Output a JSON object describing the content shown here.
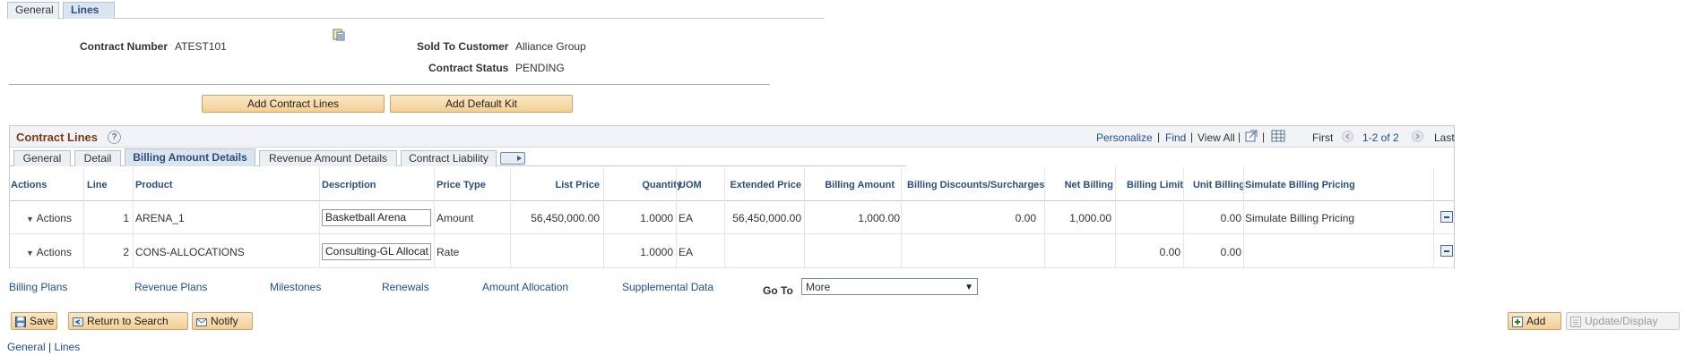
{
  "top_tabs": [
    "General",
    "Lines"
  ],
  "header": {
    "contract_number_label": "Contract Number",
    "contract_number": "ATEST101",
    "sold_to_label": "Sold To Customer",
    "sold_to": "Alliance Group",
    "status_label": "Contract Status",
    "status": "PENDING"
  },
  "buttons": {
    "add_contract_lines": "Add Contract Lines",
    "add_default_kit": "Add Default Kit"
  },
  "grid": {
    "title": "Contract Lines",
    "personalize": "Personalize",
    "find": "Find",
    "view_all": "View All",
    "first": "First",
    "range": "1-2 of 2",
    "last": "Last",
    "tabs": [
      "General",
      "Detail",
      "Billing Amount Details",
      "Revenue Amount Details",
      "Contract Liability"
    ],
    "columns": [
      "Actions",
      "Line",
      "Product",
      "Description",
      "Price Type",
      "List Price",
      "Quantity",
      "UOM",
      "Extended Price",
      "Billing Amount",
      "Billing Discounts/Surcharges",
      "Net Billing",
      "Billing Limit",
      "Unit Billing",
      "Simulate Billing Pricing"
    ],
    "rows": [
      {
        "actions": "Actions",
        "line": "1",
        "product": "ARENA_1",
        "description": "Basketball Arena",
        "price_type": "Amount",
        "list_price": "56,450,000.00",
        "quantity": "1.0000",
        "uom": "EA",
        "extended_price": "56,450,000.00",
        "billing_amount": "1,000.00",
        "discounts": "0.00",
        "net_billing": "1,000.00",
        "billing_limit": "",
        "unit_billing": "0.00",
        "simulate": "Simulate Billing Pricing"
      },
      {
        "actions": "Actions",
        "line": "2",
        "product": "CONS-ALLOCATIONS",
        "description": "Consulting-GL Allocat",
        "price_type": "Rate",
        "list_price": "",
        "quantity": "1.0000",
        "uom": "EA",
        "extended_price": "",
        "billing_amount": "",
        "discounts": "",
        "net_billing": "",
        "billing_limit": "0.00",
        "unit_billing": "0.00",
        "simulate": ""
      }
    ]
  },
  "links": [
    "Billing Plans",
    "Revenue Plans",
    "Milestones",
    "Renewals",
    "Amount Allocation",
    "Supplemental Data"
  ],
  "goto": {
    "label": "Go To",
    "selected": "More"
  },
  "toolbar": {
    "save": "Save",
    "return_to_search": "Return to Search",
    "notify": "Notify",
    "add": "Add",
    "update_display": "Update/Display"
  },
  "footer": {
    "general": "General",
    "sep": "|",
    "lines": "Lines"
  }
}
